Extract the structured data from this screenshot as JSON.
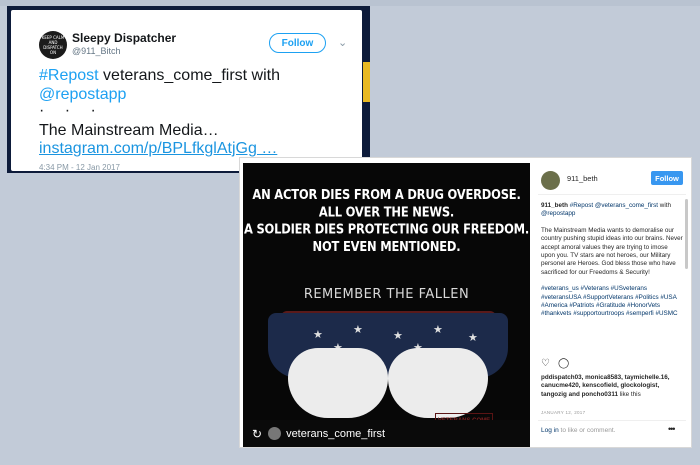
{
  "tweet": {
    "display_name": "Sleepy Dispatcher",
    "handle": "@911_Bitch",
    "avatar_text": "KEEP CALM AND DISPATCH ON",
    "follow_label": "Follow",
    "line1_hashtag": "#Repost",
    "line1_rest": " veterans_come_first with",
    "line2_mention": "@repostapp",
    "dots": "· · ·",
    "line3": "The Mainstream Media…",
    "link": "instagram.com/p/BPLfkglAtjGg …",
    "timestamp": "4:34 PM - 12 Jan 2017",
    "chevron_icon": "chevron-down-icon"
  },
  "instagram": {
    "photo": {
      "headline": [
        "AN ACTOR DIES FROM A DRUG OVERDOSE.",
        "ALL OVER THE NEWS.",
        "A SOLDIER DIES PROTECTING OUR FREEDOM.",
        "NOT EVEN MENTIONED."
      ],
      "subtitle": "REMEMBER THE FALLEN",
      "watermark": "VETERANS COME FIRST"
    },
    "repost_bar": {
      "icon": "repost-icon",
      "username": "veterans_come_first"
    },
    "username": "911_beth",
    "follow_label": "Follow",
    "caption": {
      "user": "911_beth",
      "intro_tag": "#Repost",
      "intro_mention": "@veterans_come_first",
      "intro_with": "with",
      "intro_app": "@repostapp",
      "body": "The Mainstream Media wants to demoralise our country pushing stupid ideas into our brains. Never accept amoral values they are trying to imose upon you. TV stars are not heroes, our Military personel are Heroes. God bless those who have sacrificed for our Freedoms & Security!",
      "hashtags": "#veterans_us #Veterans #USveterans #veteransUSA #SupportVeterans #Politics #USA #America #Patriots #Gratitude #HonorVets #thankvets #supportourtroops #semperfi #USMC"
    },
    "actions": {
      "like_icon": "heart-icon",
      "comment_icon": "comment-icon"
    },
    "likes_users": "pddispatch03, monica8583, taymichelle.16, canucme420, kenscofield, glockologist, tangozig and poncho0311",
    "likes_suffix": " like this",
    "date": "JANUARY 12, 2017",
    "login_link": "Log in",
    "login_rest": " to like or comment.",
    "more_icon": "more-options-icon"
  }
}
